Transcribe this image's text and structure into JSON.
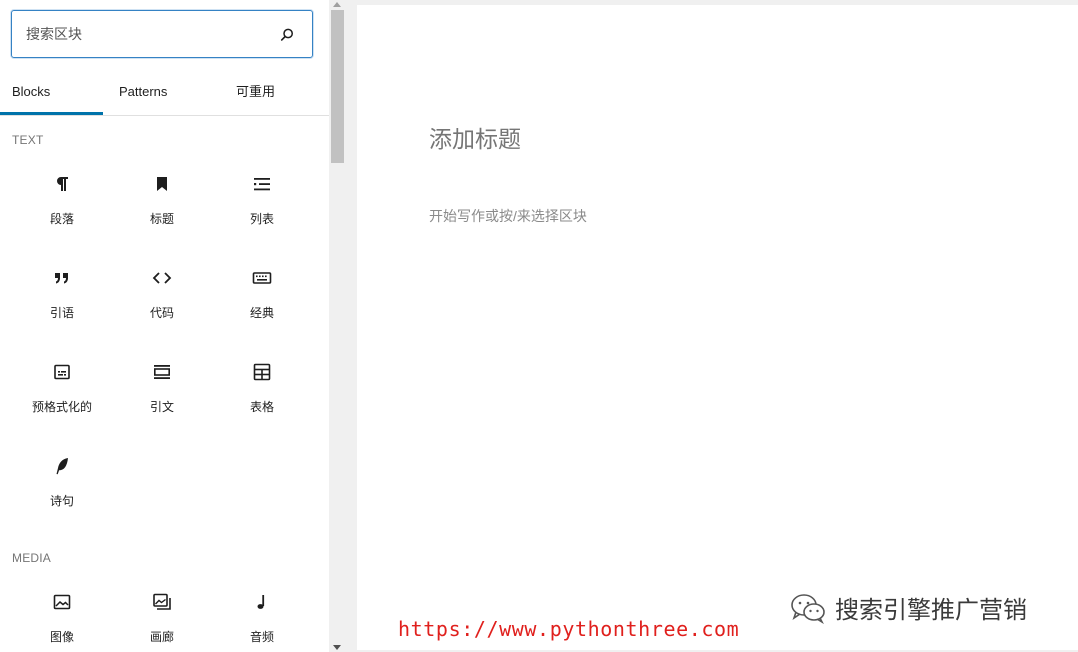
{
  "search": {
    "placeholder": "搜索区块"
  },
  "tabs": [
    {
      "label": "Blocks",
      "active": true
    },
    {
      "label": "Patterns",
      "active": false
    },
    {
      "label": "可重用",
      "active": false
    }
  ],
  "categories": {
    "text": {
      "title": "TEXT",
      "blocks": [
        {
          "label": "段落",
          "icon": "paragraph-icon"
        },
        {
          "label": "标题",
          "icon": "bookmark-icon"
        },
        {
          "label": "列表",
          "icon": "list-icon"
        },
        {
          "label": "引语",
          "icon": "quote-icon"
        },
        {
          "label": "代码",
          "icon": "code-icon"
        },
        {
          "label": "经典",
          "icon": "keyboard-icon"
        },
        {
          "label": "预格式化的",
          "icon": "preformatted-icon"
        },
        {
          "label": "引文",
          "icon": "pullquote-icon"
        },
        {
          "label": "表格",
          "icon": "table-icon"
        },
        {
          "label": "诗句",
          "icon": "feather-icon"
        }
      ]
    },
    "media": {
      "title": "MEDIA",
      "blocks": [
        {
          "label": "图像",
          "icon": "image-icon"
        },
        {
          "label": "画廊",
          "icon": "gallery-icon"
        },
        {
          "label": "音频",
          "icon": "audio-icon"
        }
      ]
    }
  },
  "editor": {
    "title_placeholder": "添加标题",
    "paragraph_placeholder": "开始写作或按/来选择区块"
  },
  "watermark": {
    "url": "https://www.pythonthree.com",
    "brand": "搜索引擎推广营销"
  },
  "colors": {
    "accent": "#0073aa",
    "search_border": "#3582c4",
    "watermark_url": "#e0201d"
  }
}
